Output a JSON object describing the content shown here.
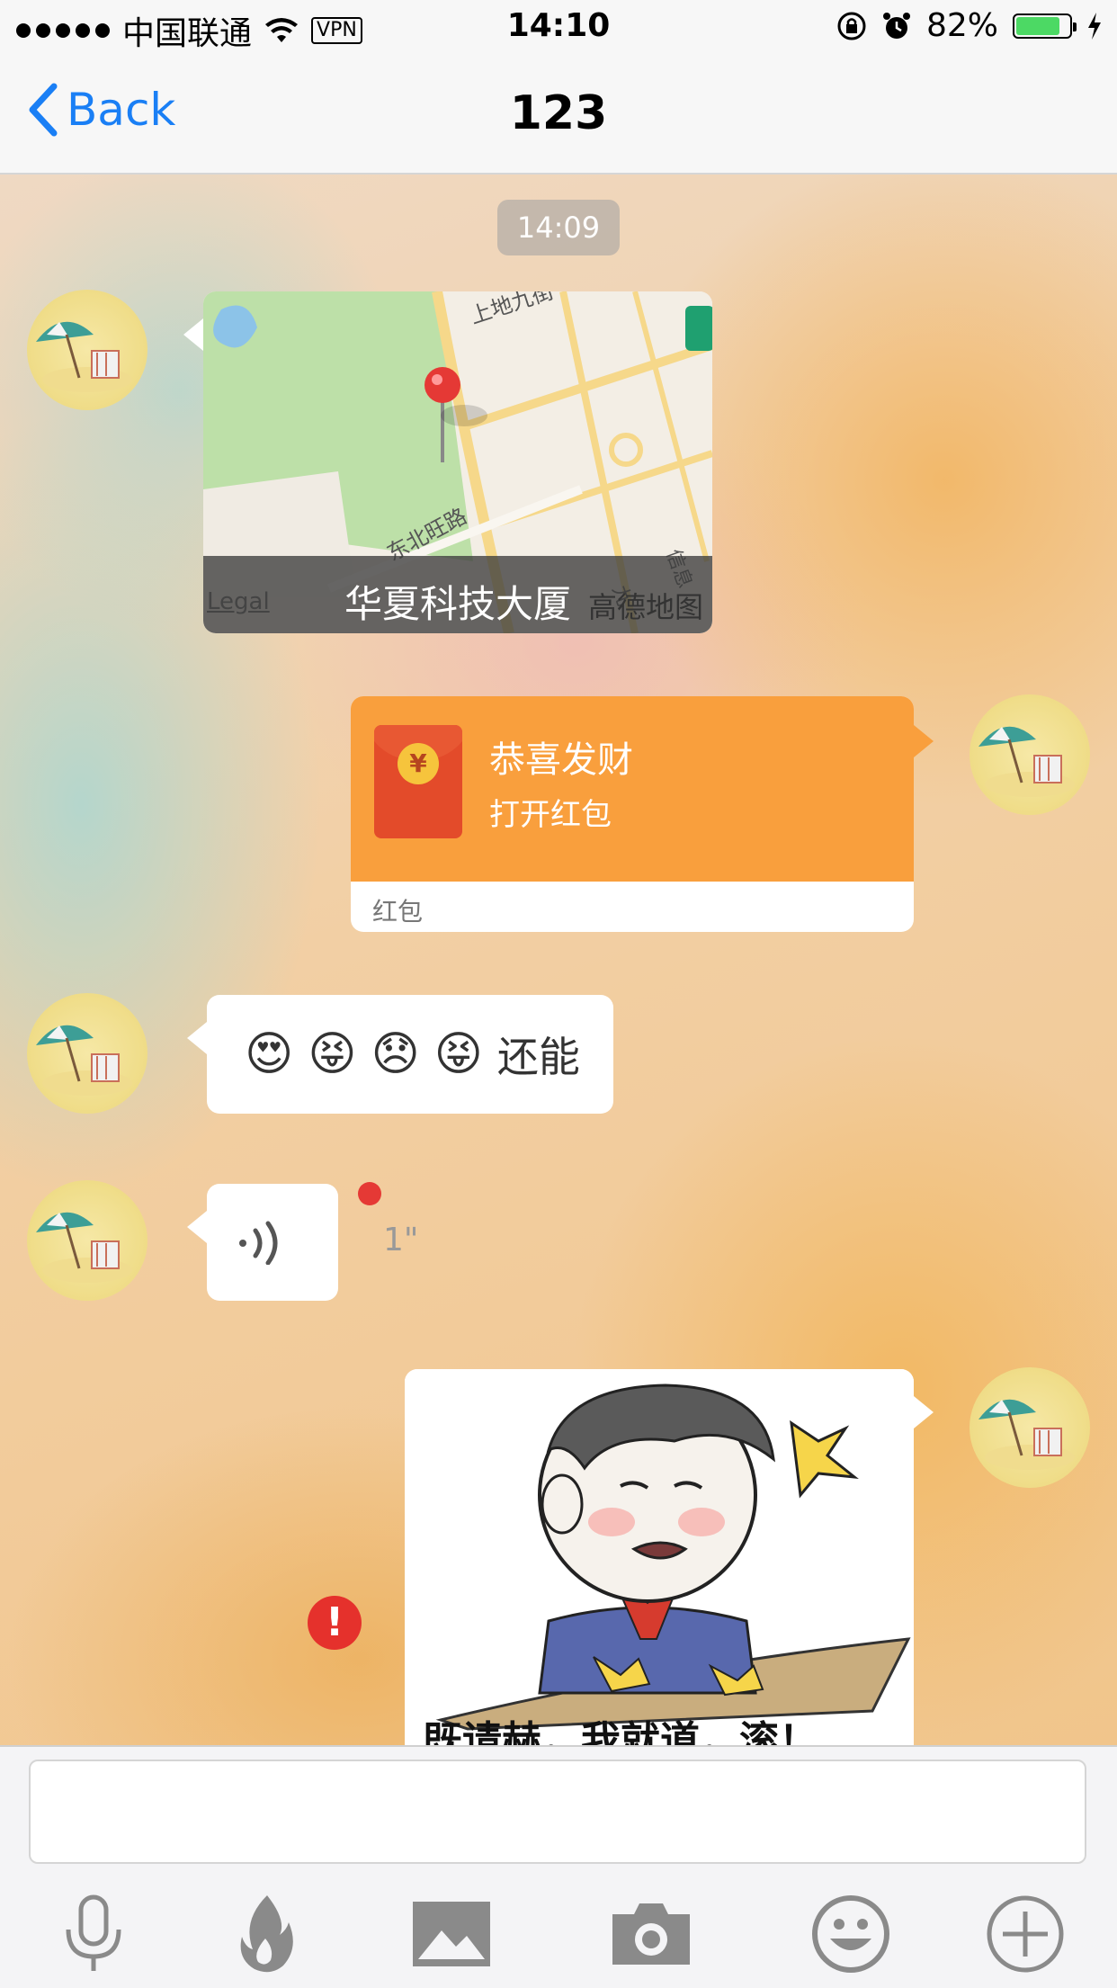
{
  "status_bar": {
    "carrier": "中国联通",
    "vpn": "VPN",
    "time": "14:10",
    "battery_percent": "82%",
    "battery_level": 0.82
  },
  "nav": {
    "back_label": "Back",
    "title": "123"
  },
  "chat": {
    "timestamp": "14:09",
    "location_message": {
      "place_name": "华夏科技大厦",
      "legal": "Legal",
      "map_provider": "高德地图",
      "map_labels": [
        "上地九街",
        "东北旺路",
        "信息",
        "九"
      ]
    },
    "red_packet_message": {
      "title": "恭喜发财",
      "subtitle": "打开红包",
      "label": "红包",
      "coin_symbol": "¥"
    },
    "text_message": {
      "emojis": [
        "😍",
        "😝",
        "😞",
        "😝"
      ],
      "text": "还能"
    },
    "voice_message": {
      "duration": "1\""
    },
    "image_message": {
      "caption_partial": "既请赫，我就道，滚！"
    },
    "send_error_symbol": "!"
  },
  "input_bar": {
    "placeholder": "",
    "tools": [
      "microphone-icon",
      "flame-icon",
      "image-icon",
      "camera-icon",
      "emoji-icon",
      "add-icon"
    ]
  },
  "colors": {
    "accent": "#1a7ff5",
    "red_packet": "#f99f3d",
    "error": "#e5312c"
  }
}
